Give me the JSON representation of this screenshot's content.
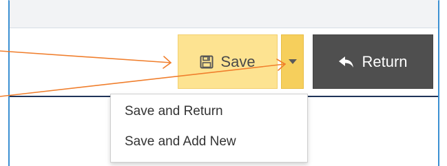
{
  "toolbar": {
    "save_label": "Save",
    "return_label": "Return"
  },
  "save_menu": {
    "items": [
      {
        "label": "Save and Return"
      },
      {
        "label": "Save and Add New"
      }
    ]
  },
  "icons": {
    "save": "floppy-disk-icon",
    "dropdown": "caret-down-icon",
    "return": "reply-arrow-icon"
  },
  "colors": {
    "save_button_bg": "#fde391",
    "dropdown_button_bg": "#f6cf5c",
    "return_button_bg": "#4f4f4f",
    "annotation_arrow": "#f07e2c",
    "frame_border": "#3a8fd2",
    "header_divider": "#1f3358"
  }
}
